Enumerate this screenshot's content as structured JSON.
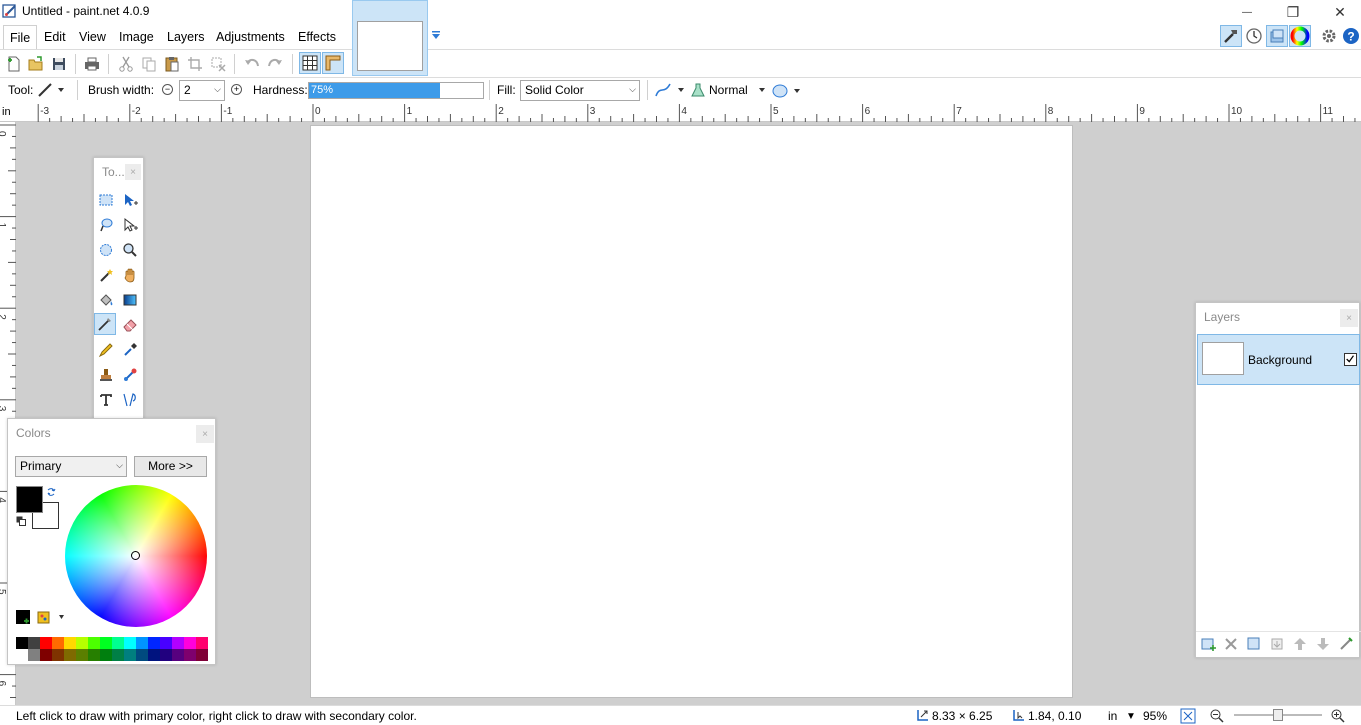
{
  "window": {
    "title": "Untitled - paint.net 4.0.9",
    "app_icon": "paintnet-app-icon",
    "minimize_glyph": "—",
    "restore_glyph": "❐",
    "close_glyph": "✕"
  },
  "menu": [
    "File",
    "Edit",
    "View",
    "Image",
    "Layers",
    "Adjustments",
    "Effects"
  ],
  "right_toolbar_icons": [
    "tools-window-icon",
    "history-window-icon",
    "layers-window-icon",
    "colors-window-icon",
    "settings-icon",
    "help-icon"
  ],
  "toolbar": {
    "icons": [
      "new-image-icon",
      "open-icon",
      "save-icon",
      "print-icon",
      "cut-icon",
      "copy-icon",
      "paste-icon",
      "crop-icon",
      "deselect-icon",
      "undo-icon",
      "redo-icon",
      "grid-icon",
      "rulers-icon"
    ]
  },
  "tool_options": {
    "tool_label": "Tool:",
    "brush_width_label": "Brush width:",
    "brush_width_value": "2",
    "hardness_label": "Hardness:",
    "hardness_value": "75%",
    "hardness_fraction": 0.75,
    "fill_label": "Fill:",
    "fill_value": "Solid Color",
    "blend_mode": "Normal"
  },
  "ruler": {
    "unit": "in",
    "top_labels": [
      "-3",
      "-2",
      "-1",
      "0",
      "1",
      "2",
      "3",
      "4",
      "5",
      "6",
      "7",
      "8",
      "9",
      "10",
      "11"
    ],
    "left_labels": [
      "0",
      "1",
      "2",
      "3",
      "4",
      "5",
      "6"
    ]
  },
  "tools_panel": {
    "title": "To...",
    "close": "×",
    "tools": [
      [
        "rectangle-select-icon",
        "move-selection-icon"
      ],
      [
        "lasso-select-icon",
        "move-selected-icon"
      ],
      [
        "ellipse-select-icon",
        "zoom-icon"
      ],
      [
        "magic-wand-icon",
        "pan-icon"
      ],
      [
        "paint-bucket-icon",
        "gradient-icon"
      ],
      [
        "paintbrush-icon",
        "eraser-icon"
      ],
      [
        "pencil-icon",
        "color-picker-icon"
      ],
      [
        "clone-stamp-icon",
        "recolor-icon"
      ],
      [
        "text-icon",
        "line-curve-icon"
      ]
    ]
  },
  "colors_panel": {
    "title": "Colors",
    "close": "×",
    "mode": "Primary",
    "more_button": "More >>",
    "primary_color": "#000000",
    "secondary_color": "#ffffff",
    "palette_top": [
      "#000000",
      "#404040",
      "#ff0000",
      "#ff6a00",
      "#ffd800",
      "#b6ff00",
      "#4cff00",
      "#00ff21",
      "#00ff90",
      "#00ffff",
      "#0094ff",
      "#0026ff",
      "#4800ff",
      "#b200ff",
      "#ff00dc",
      "#ff006e"
    ],
    "palette_bottom": [
      "#ffffff",
      "#808080",
      "#7f0000",
      "#7f3300",
      "#7f6a00",
      "#5b7f00",
      "#267f00",
      "#007f0e",
      "#007f46",
      "#007f7f",
      "#004a7f",
      "#00137f",
      "#21007f",
      "#57007f",
      "#7f006e",
      "#7f0037"
    ]
  },
  "layers_panel": {
    "title": "Layers",
    "close": "×",
    "layer_name": "Background",
    "layer_visible": true,
    "footer_icons": [
      "add-layer-icon",
      "delete-layer-icon",
      "duplicate-layer-icon",
      "merge-layer-down-icon",
      "move-layer-up-icon",
      "move-layer-down-icon",
      "layer-properties-icon"
    ]
  },
  "status": {
    "hint": "Left click to draw with primary color, right click to draw with secondary color.",
    "image_size": "8.33 × 6.25",
    "cursor_position": "1.84, 0.10",
    "units": "in",
    "zoom": "95%",
    "zoom_fraction": 0.5
  },
  "colors": {
    "accent": "#3d9be9",
    "selection_bg": "#cce4f7",
    "workspace": "#cfcfcf"
  }
}
